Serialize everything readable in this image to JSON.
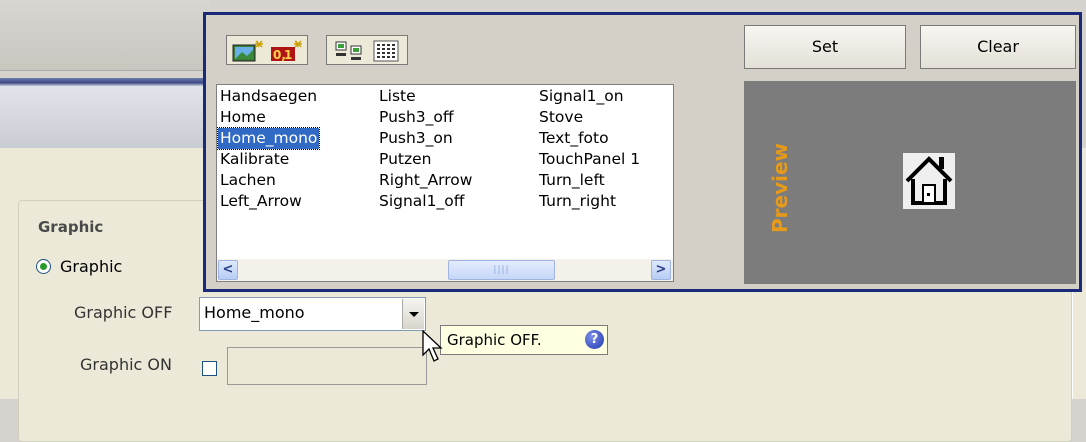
{
  "group": {
    "title": "Graphic"
  },
  "radio": {
    "label": "Graphic"
  },
  "graphic_off": {
    "label": "Graphic OFF",
    "value": "Home_mono"
  },
  "graphic_on": {
    "label": "Graphic ON",
    "checked": false,
    "value": ""
  },
  "tooltip": {
    "text": "Graphic OFF.",
    "help_icon": "?"
  },
  "popup": {
    "set_label": "Set",
    "clear_label": "Clear",
    "preview_label": "Preview",
    "toolbar_icons": [
      "image-import-icon",
      "image-export-icon",
      "small-icons-view-icon",
      "list-view-icon"
    ],
    "list": {
      "columns": [
        [
          "Handsaegen",
          "Home",
          "Home_mono",
          "Kalibrate",
          "Lachen",
          "Left_Arrow"
        ],
        [
          "Liste",
          "Push3_off",
          "Push3_on",
          "Putzen",
          "Right_Arrow",
          "Signal1_off"
        ],
        [
          "Signal1_on",
          "Stove",
          "Text_foto",
          "TouchPanel 1",
          "Turn_left",
          "Turn_right"
        ]
      ],
      "selected": "Home_mono"
    },
    "scroll": {
      "left_arrow": "<",
      "right_arrow": ">",
      "thumb_grip": "||||"
    }
  },
  "colors": {
    "selection": "#316ac5",
    "popup_border": "#1a2a7a",
    "preview_bg": "#7c7c7c",
    "preview_label": "#e69a1a"
  }
}
